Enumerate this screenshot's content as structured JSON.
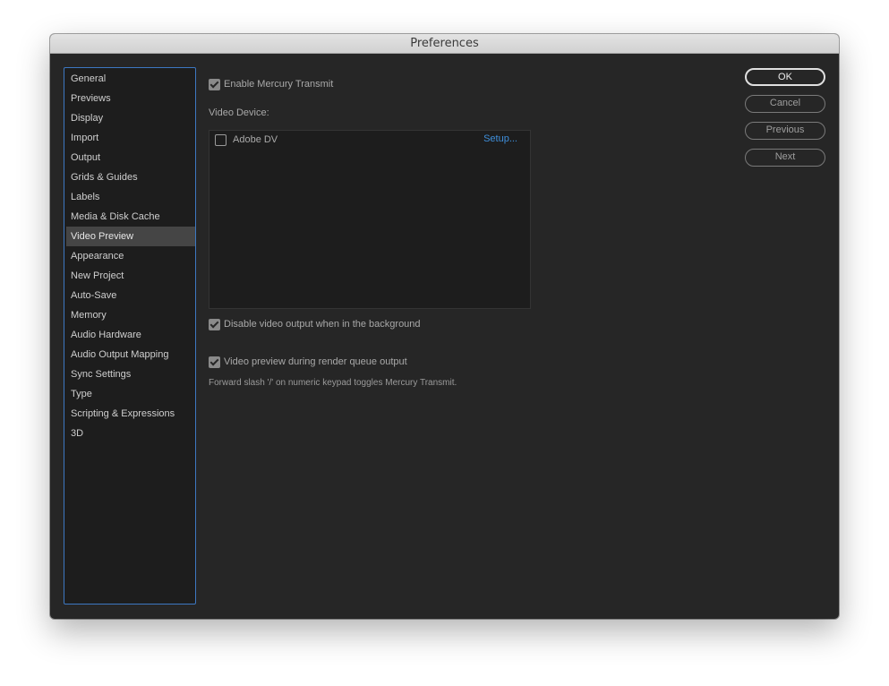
{
  "window": {
    "title": "Preferences"
  },
  "sidebar": {
    "items": [
      {
        "label": "General"
      },
      {
        "label": "Previews"
      },
      {
        "label": "Display"
      },
      {
        "label": "Import"
      },
      {
        "label": "Output"
      },
      {
        "label": "Grids & Guides"
      },
      {
        "label": "Labels"
      },
      {
        "label": "Media & Disk Cache"
      },
      {
        "label": "Video Preview",
        "selected": true
      },
      {
        "label": "Appearance"
      },
      {
        "label": "New Project"
      },
      {
        "label": "Auto-Save"
      },
      {
        "label": "Memory"
      },
      {
        "label": "Audio Hardware"
      },
      {
        "label": "Audio Output Mapping"
      },
      {
        "label": "Sync Settings"
      },
      {
        "label": "Type"
      },
      {
        "label": "Scripting & Expressions"
      },
      {
        "label": "3D"
      }
    ]
  },
  "main": {
    "enable_mercury": {
      "label": "Enable Mercury Transmit",
      "checked": true
    },
    "video_device_label": "Video Device:",
    "devices": [
      {
        "name": "Adobe DV",
        "checked": false,
        "setup_label": "Setup..."
      }
    ],
    "disable_bg": {
      "label": "Disable video output when in the background",
      "checked": true
    },
    "render_preview": {
      "label": "Video preview during render queue output",
      "checked": true
    },
    "note": "Forward slash '/' on numeric keypad toggles Mercury Transmit."
  },
  "buttons": {
    "ok": "OK",
    "cancel": "Cancel",
    "previous": "Previous",
    "next": "Next"
  },
  "colors": {
    "accent": "#3d78c2",
    "link": "#3f8fdb",
    "background": "#262626"
  }
}
